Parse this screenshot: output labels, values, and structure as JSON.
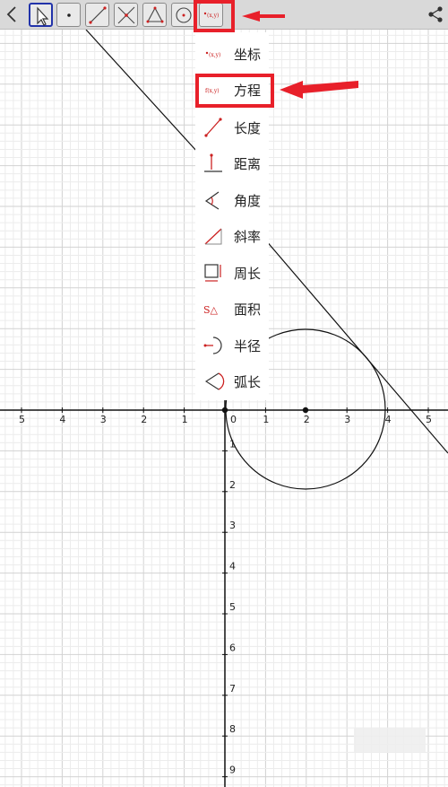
{
  "toolbar": {
    "tools": [
      {
        "name": "back"
      },
      {
        "name": "pointer-tool"
      },
      {
        "name": "point-tool"
      },
      {
        "name": "segment-tool"
      },
      {
        "name": "intersect-tool"
      },
      {
        "name": "triangle-tool"
      },
      {
        "name": "circle-tool"
      },
      {
        "name": "measure-tool",
        "icon_text": "(x,y)"
      }
    ]
  },
  "menu": {
    "items": [
      {
        "key": "coord",
        "label": "坐标",
        "icon": "coordinate-icon",
        "icon_text": "(x,y)"
      },
      {
        "key": "equation",
        "label": "方程",
        "icon": "equation-icon",
        "icon_text": "f(x,y)"
      },
      {
        "key": "length",
        "label": "长度",
        "icon": "length-icon"
      },
      {
        "key": "distance",
        "label": "距离",
        "icon": "distance-icon"
      },
      {
        "key": "angle",
        "label": "角度",
        "icon": "angle-icon"
      },
      {
        "key": "slope",
        "label": "斜率",
        "icon": "slope-icon"
      },
      {
        "key": "perimeter",
        "label": "周长",
        "icon": "perimeter-icon"
      },
      {
        "key": "area",
        "label": "面积",
        "icon": "area-icon",
        "icon_text": "S△"
      },
      {
        "key": "radius",
        "label": "半径",
        "icon": "radius-icon"
      },
      {
        "key": "arc",
        "label": "弧长",
        "icon": "arc-length-icon"
      }
    ]
  },
  "axes": {
    "x_ticks": [
      "5",
      "4",
      "3",
      "2",
      "1",
      "0",
      "1",
      "2",
      "3",
      "4",
      "5"
    ],
    "y_ticks": [
      "1",
      "2",
      "3",
      "4",
      "5",
      "6",
      "7",
      "8",
      "9"
    ]
  },
  "colors": {
    "highlight": "#e8202a",
    "selected_border": "#2233aa",
    "toolbar": "#d9d9d9"
  }
}
